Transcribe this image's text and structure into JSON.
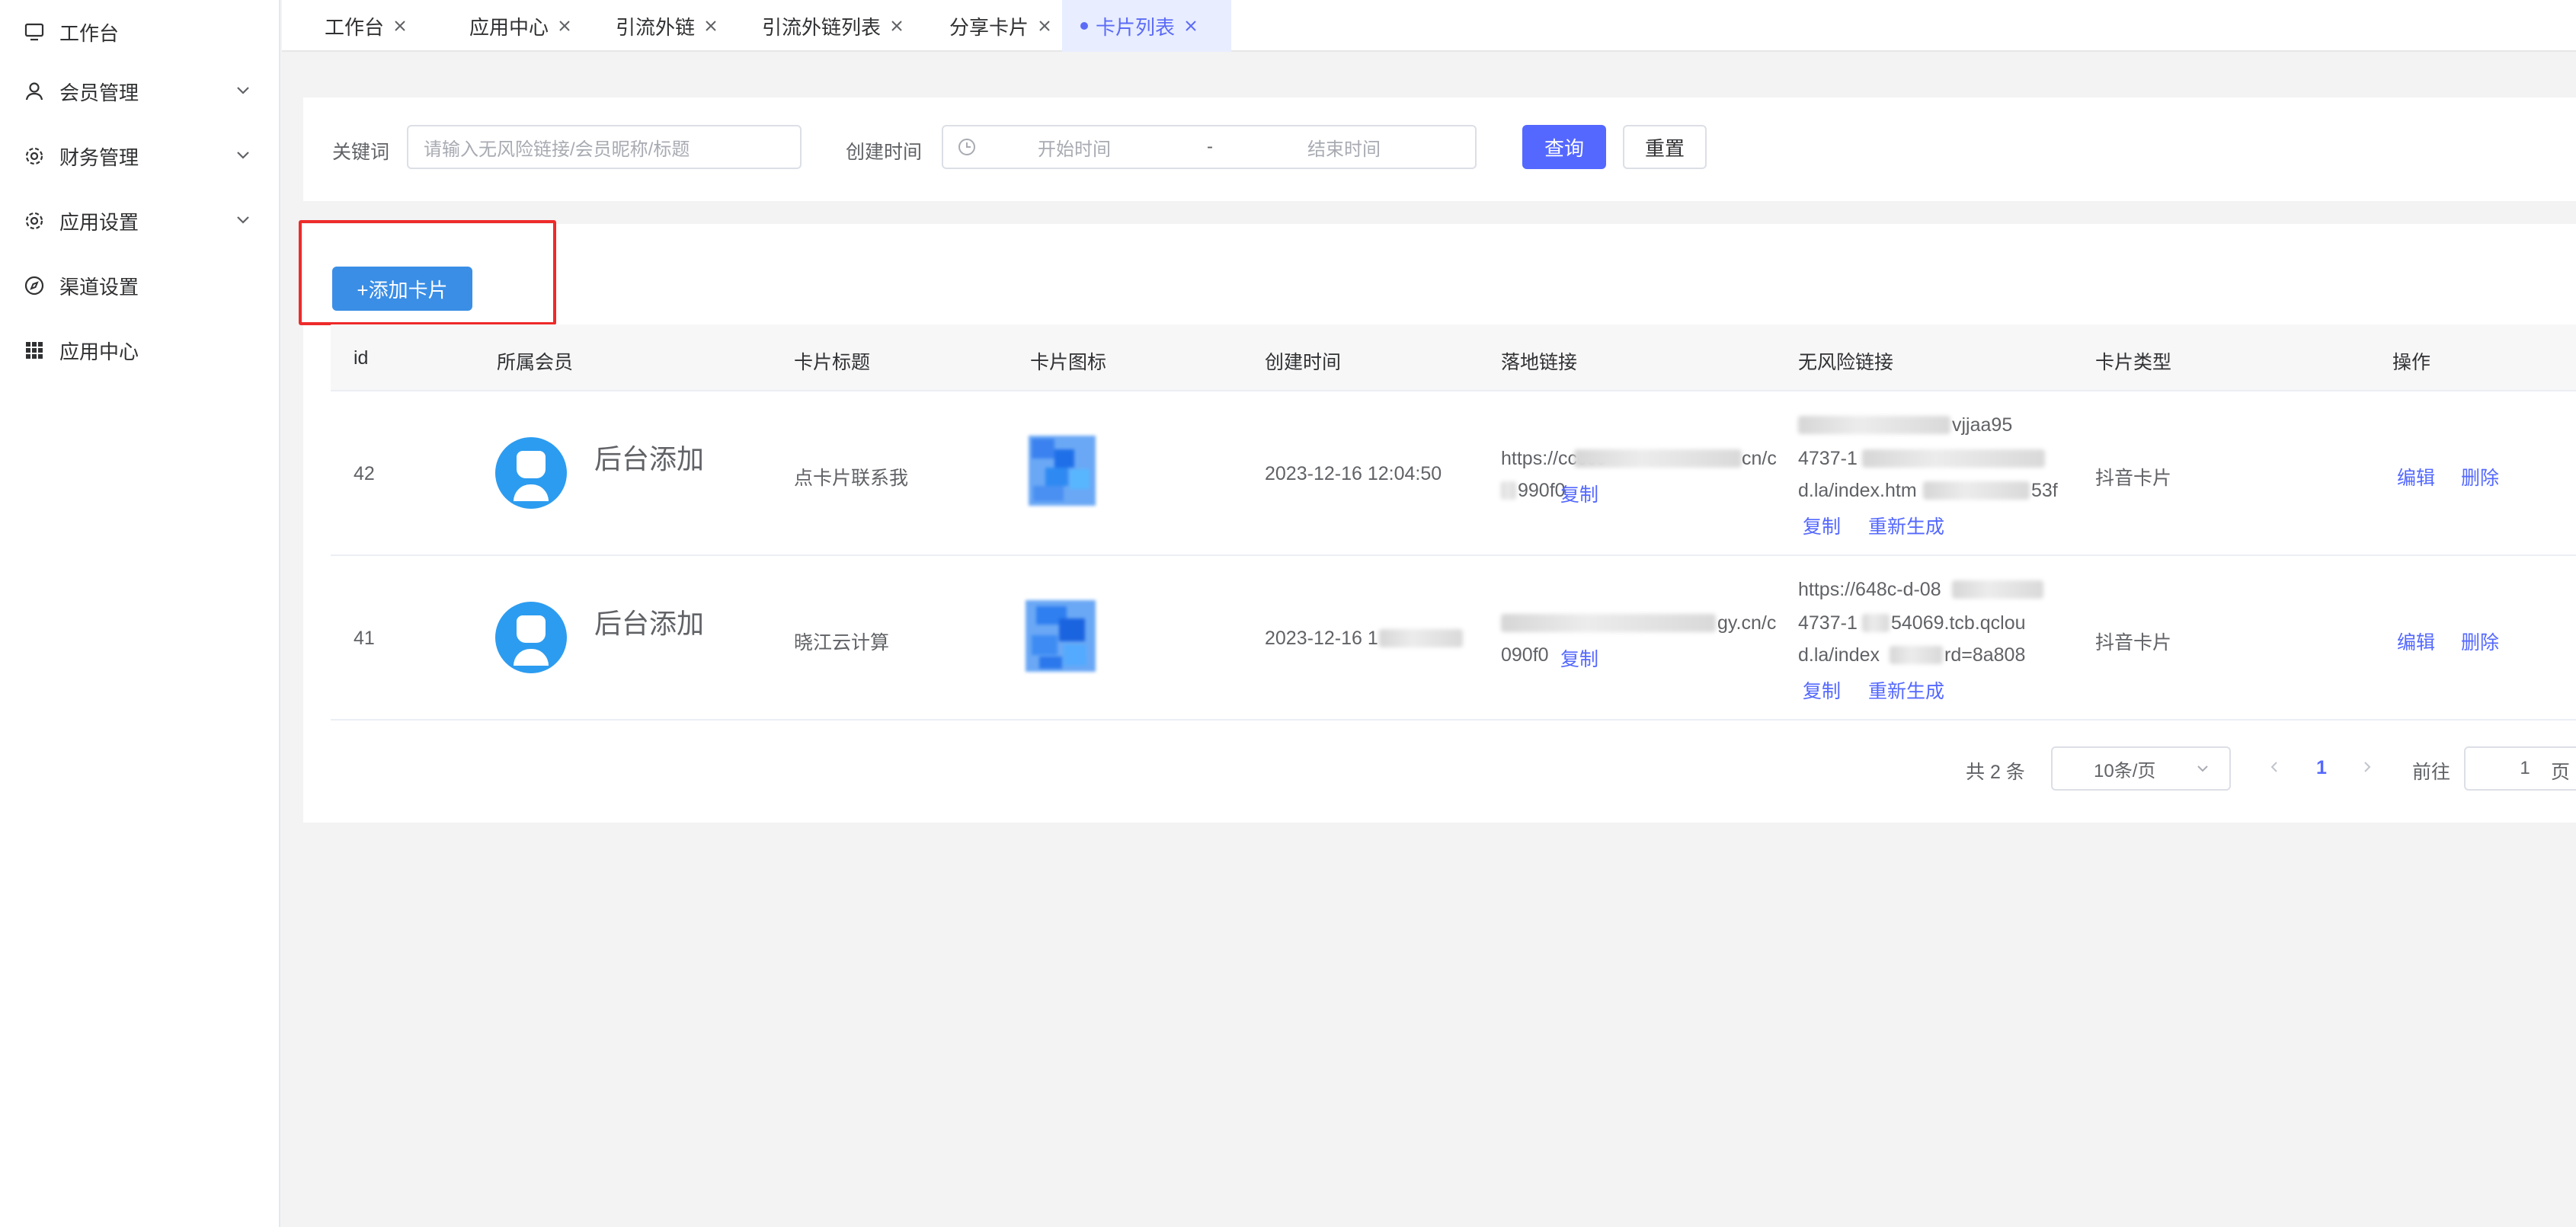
{
  "sidebar": {
    "items": [
      {
        "label": "工作台",
        "icon": "monitor-icon",
        "expandable": false
      },
      {
        "label": "会员管理",
        "icon": "user-icon",
        "expandable": true
      },
      {
        "label": "财务管理",
        "icon": "gear-icon",
        "expandable": true
      },
      {
        "label": "应用设置",
        "icon": "gear-icon",
        "expandable": true
      },
      {
        "label": "渠道设置",
        "icon": "compass-icon",
        "expandable": false
      },
      {
        "label": "应用中心",
        "icon": "grid-icon",
        "expandable": false
      }
    ]
  },
  "tabs": [
    {
      "label": "工作台"
    },
    {
      "label": "应用中心"
    },
    {
      "label": "引流外链"
    },
    {
      "label": "引流外链列表"
    },
    {
      "label": "分享卡片"
    },
    {
      "label": "卡片列表",
      "active": true
    }
  ],
  "search": {
    "keyword_label": "关键词",
    "keyword_placeholder": "请输入无风险链接/会员昵称/标题",
    "created_label": "创建时间",
    "start_placeholder": "开始时间",
    "range_sep": "-",
    "end_placeholder": "结束时间",
    "query_button": "查询",
    "reset_button": "重置"
  },
  "add_button": "+添加卡片",
  "table": {
    "columns": [
      "id",
      "所属会员",
      "卡片标题",
      "卡片图标",
      "创建时间",
      "落地链接",
      "无风险链接",
      "卡片类型",
      "操作"
    ],
    "rows": [
      {
        "id": "42",
        "member": "后台添加",
        "title": "点卡片联系我",
        "created": "2023-12-16 12:04:50",
        "landing_visible_1": "https://ccccc",
        "landing_visible_2": "cn/c",
        "landing_line2": "990f0",
        "copy": "复制",
        "safe_line1": "vjjaa95",
        "safe_line2": "4737-1",
        "safe_line3": "d.la/index.htm",
        "safe_line3b": "53f",
        "safe_copy": "复制",
        "regen": "重新生成",
        "type": "抖音卡片",
        "edit": "编辑",
        "delete": "删除"
      },
      {
        "id": "41",
        "member": "后台添加",
        "title": "晓江云计算",
        "created": "2023-12-16 1",
        "landing_visible_2": "gy.cn/c",
        "landing_line2": "090f0",
        "copy": "复制",
        "safe_line1": "https://648c-d-08",
        "safe_line2": "4737-1",
        "safe_line2b": "54069.tcb.qclou",
        "safe_line3": "d.la/index",
        "safe_line3b": "rd=8a808",
        "safe_copy": "复制",
        "regen": "重新生成",
        "type": "抖音卡片",
        "edit": "编辑",
        "delete": "删除"
      }
    ]
  },
  "pagination": {
    "total": "共 2 条",
    "page_size": "10条/页",
    "current_page": "1",
    "goto_label": "前往",
    "goto_value": "1",
    "page_suffix": "页"
  },
  "colors": {
    "primary": "#5468ff",
    "add_button": "#3a8ee6",
    "highlight_box": "#ee2a2a"
  }
}
